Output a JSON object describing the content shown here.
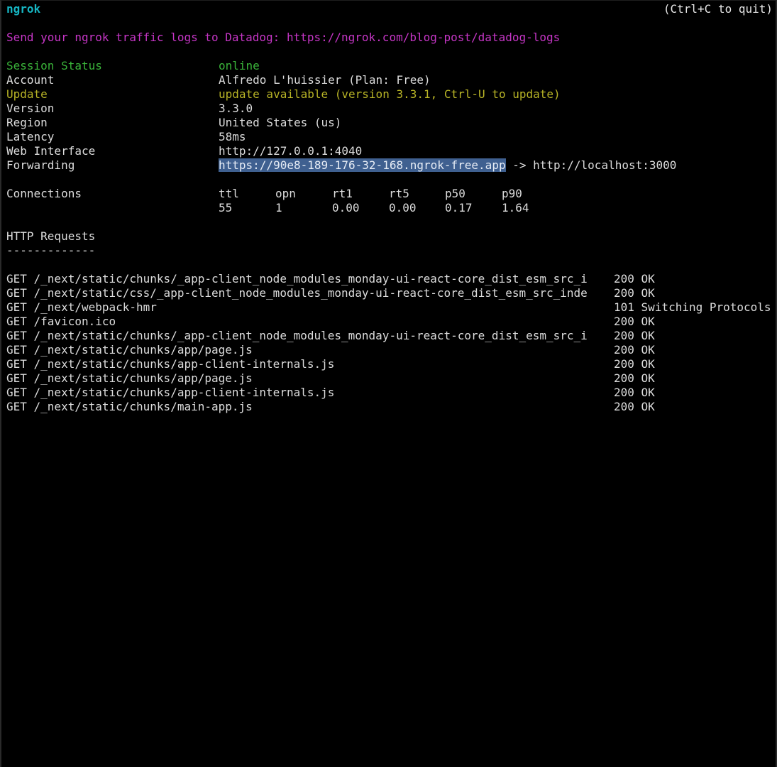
{
  "header": {
    "app_name": "ngrok",
    "quit_hint": "(Ctrl+C to quit)"
  },
  "banner": {
    "text": "Send your ngrok traffic logs to Datadog: https://ngrok.com/blog-post/datadog-logs"
  },
  "session": {
    "status_label": "Session Status",
    "status_value": "online",
    "account_label": "Account",
    "account_value": "Alfredo L'huissier (Plan: Free)",
    "update_label": "Update",
    "update_value": "update available (version 3.3.1, Ctrl-U to update)",
    "version_label": "Version",
    "version_value": "3.3.0",
    "region_label": "Region",
    "region_value": "United States (us)",
    "latency_label": "Latency",
    "latency_value": "58ms",
    "web_label": "Web Interface",
    "web_value": "http://127.0.0.1:4040",
    "forwarding_label": "Forwarding",
    "forwarding_public": "https://90e8-189-176-32-168.ngrok-free.app",
    "forwarding_arrow": " -> ",
    "forwarding_local": "http://localhost:3000"
  },
  "connections": {
    "label": "Connections",
    "headers": [
      "ttl",
      "opn",
      "rt1",
      "rt5",
      "p50",
      "p90"
    ],
    "values": [
      "55",
      "1",
      "0.00",
      "0.00",
      "0.17",
      "1.64"
    ]
  },
  "requests": {
    "title": "HTTP Requests",
    "underline": "-------------",
    "rows": [
      {
        "path": "GET /_next/static/chunks/_app-client_node_modules_monday-ui-react-core_dist_esm_src_i",
        "status": "200 OK"
      },
      {
        "path": "GET /_next/static/css/_app-client_node_modules_monday-ui-react-core_dist_esm_src_inde",
        "status": "200 OK"
      },
      {
        "path": "GET /_next/webpack-hmr",
        "status": "101 Switching Protocols"
      },
      {
        "path": "GET /favicon.ico",
        "status": "200 OK"
      },
      {
        "path": "GET /_next/static/chunks/_app-client_node_modules_monday-ui-react-core_dist_esm_src_i",
        "status": "200 OK"
      },
      {
        "path": "GET /_next/static/chunks/app/page.js",
        "status": "200 OK"
      },
      {
        "path": "GET /_next/static/chunks/app-client-internals.js",
        "status": "200 OK"
      },
      {
        "path": "GET /_next/static/chunks/app/page.js",
        "status": "200 OK"
      },
      {
        "path": "GET /_next/static/chunks/app-client-internals.js",
        "status": "200 OK"
      },
      {
        "path": "GET /_next/static/chunks/main-app.js",
        "status": "200 OK"
      }
    ]
  },
  "colors": {
    "background": "#000000",
    "text": "#dcdcdc",
    "app_name": "#16b7c4",
    "banner": "#c636c6",
    "online": "#3ab43a",
    "update": "#b8b426",
    "selection": "#3f6090"
  }
}
